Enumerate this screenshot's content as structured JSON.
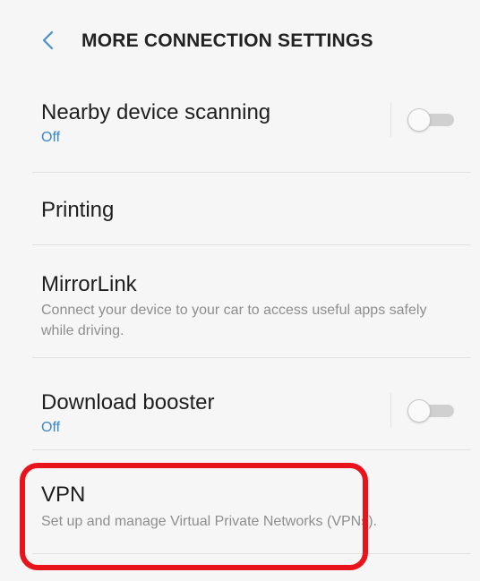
{
  "header": {
    "title": "MORE CONNECTION SETTINGS",
    "back_icon": "chevron-left-icon"
  },
  "items": [
    {
      "label": "Nearby device scanning",
      "subtitle": "Off",
      "toggle": "off"
    },
    {
      "label": "Printing"
    },
    {
      "label": "MirrorLink",
      "subtitle": "Connect your device to your car to access useful apps safely while driving."
    },
    {
      "label": "Download booster",
      "subtitle": "Off",
      "toggle": "off"
    },
    {
      "label": "VPN",
      "subtitle": "Set up and manage Virtual Private Networks (VPNs)."
    }
  ],
  "colors": {
    "background": "#f6f6f6",
    "accent_status": "#3b86c6",
    "highlight_outline": "#e8131b"
  }
}
